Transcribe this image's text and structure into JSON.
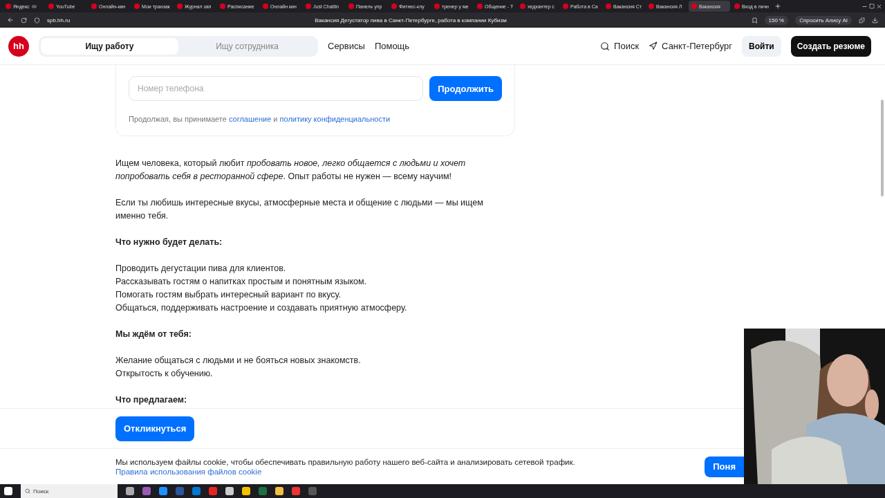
{
  "browser": {
    "tabs": [
      {
        "label": "Яндекс",
        "selected": false,
        "audio": true
      },
      {
        "label": "YouTube",
        "selected": false
      },
      {
        "label": "Онлайн-кин",
        "selected": false
      },
      {
        "label": "Мои транзак",
        "selected": false
      },
      {
        "label": "Журнал зап",
        "selected": false
      },
      {
        "label": "Расписание",
        "selected": false
      },
      {
        "label": "Онлайн кин",
        "selected": false
      },
      {
        "label": "Just Chattin",
        "selected": false
      },
      {
        "label": "Панель упр",
        "selected": false
      },
      {
        "label": "Фитнес-клу",
        "selected": false
      },
      {
        "label": "тренер у ме",
        "selected": false
      },
      {
        "label": "Общение - T",
        "selected": false
      },
      {
        "label": "хедхантер с",
        "selected": false
      },
      {
        "label": "Работа в Са",
        "selected": false
      },
      {
        "label": "Вакансия Ст",
        "selected": false
      },
      {
        "label": "Вакансия Л",
        "selected": false
      },
      {
        "label": "Вакансия",
        "selected": true
      },
      {
        "label": "Вход в личн",
        "selected": false
      }
    ],
    "address": "spb.hh.ru",
    "page_title": "Вакансия Дегустатор пива в Санкт-Петербурге, работа в компании Кубизм",
    "zoom": "150 %",
    "assistant": "Спросить Алису AI"
  },
  "header": {
    "logo": "hh",
    "modes": [
      {
        "label": "Ищу работу",
        "selected": true
      },
      {
        "label": "Ищу сотрудника",
        "selected": false
      }
    ],
    "nav": [
      "Сервисы",
      "Помощь"
    ],
    "search": "Поиск",
    "city": "Санкт-Петербург",
    "login": "Войти",
    "create": "Создать резюме"
  },
  "phone_card": {
    "placeholder": "Номер телефона",
    "button": "Продолжить",
    "consent": "Продолжая, вы принимаете",
    "link1": "соглашение",
    "and": "и",
    "link2": "политику конфиденциальности"
  },
  "description": [
    {
      "kind": "paragraph",
      "text": "Ищем человека, который любит *пробовать новое, легко общается с людьми и хочет попробовать себя в ресторанной сфере*. Опыт работы не нужен — всему научим!"
    },
    {
      "kind": "paragraph",
      "text": "Если ты любишь интересные вкусы, атмосферные места и общение с людьми — мы ищем именно тебя."
    },
    {
      "kind": "heading",
      "text": "Что нужно будет делать:"
    },
    {
      "kind": "lines",
      "lines": [
        "Проводить дегустации пива для клиентов.",
        "Рассказывать гостям о напитках простым и понятным языком.",
        "Помогать гостям выбрать интересный вариант по вкусу.",
        "Общаться, поддерживать настроение и создавать приятную атмосферу."
      ]
    },
    {
      "kind": "heading",
      "text": "Мы ждём от тебя:"
    },
    {
      "kind": "lines",
      "lines": [
        "Желание общаться с людьми и не бояться новых знакомств.",
        "Открытость к обучению."
      ]
    },
    {
      "kind": "heading",
      "text": "Что предлагаем:"
    }
  ],
  "respond_button": "Откликнуться",
  "cookie": {
    "text": "Мы используем файлы cookie, чтобы обеспечивать правильную работу нашего веб-сайта и анализировать сетевой трафик.",
    "link": "Правила использования файлов cookie",
    "button": "Поня"
  },
  "taskbar": {
    "search": "Поиск"
  }
}
